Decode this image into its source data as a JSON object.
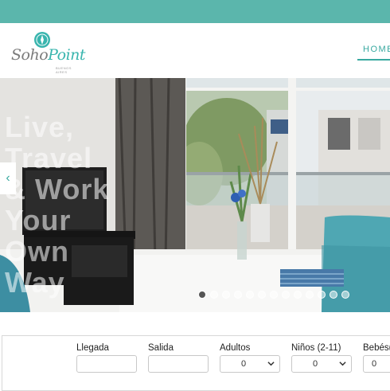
{
  "header": {
    "logo_text_1": "Soho",
    "logo_text_2": "Point",
    "logo_sub": "BUENOS AIRES",
    "nav_home": "HOME"
  },
  "hero": {
    "slogan": [
      "Live,",
      "Travel",
      "& Work",
      "Your",
      "Own",
      "Way"
    ],
    "prev_arrow": "‹",
    "slide_count": 13,
    "active_slide": 1
  },
  "booking": {
    "llegada_label": "Llegada",
    "salida_label": "Salida",
    "adultos_label": "Adultos",
    "adultos_value": "0",
    "ninos_label": "Niños (2-11)",
    "ninos_value": "0",
    "bebes_label": "Bebés(",
    "bebes_value": "0"
  },
  "colors": {
    "brand_teal": "#5bb6ac",
    "nav_teal": "#39a9a0"
  }
}
